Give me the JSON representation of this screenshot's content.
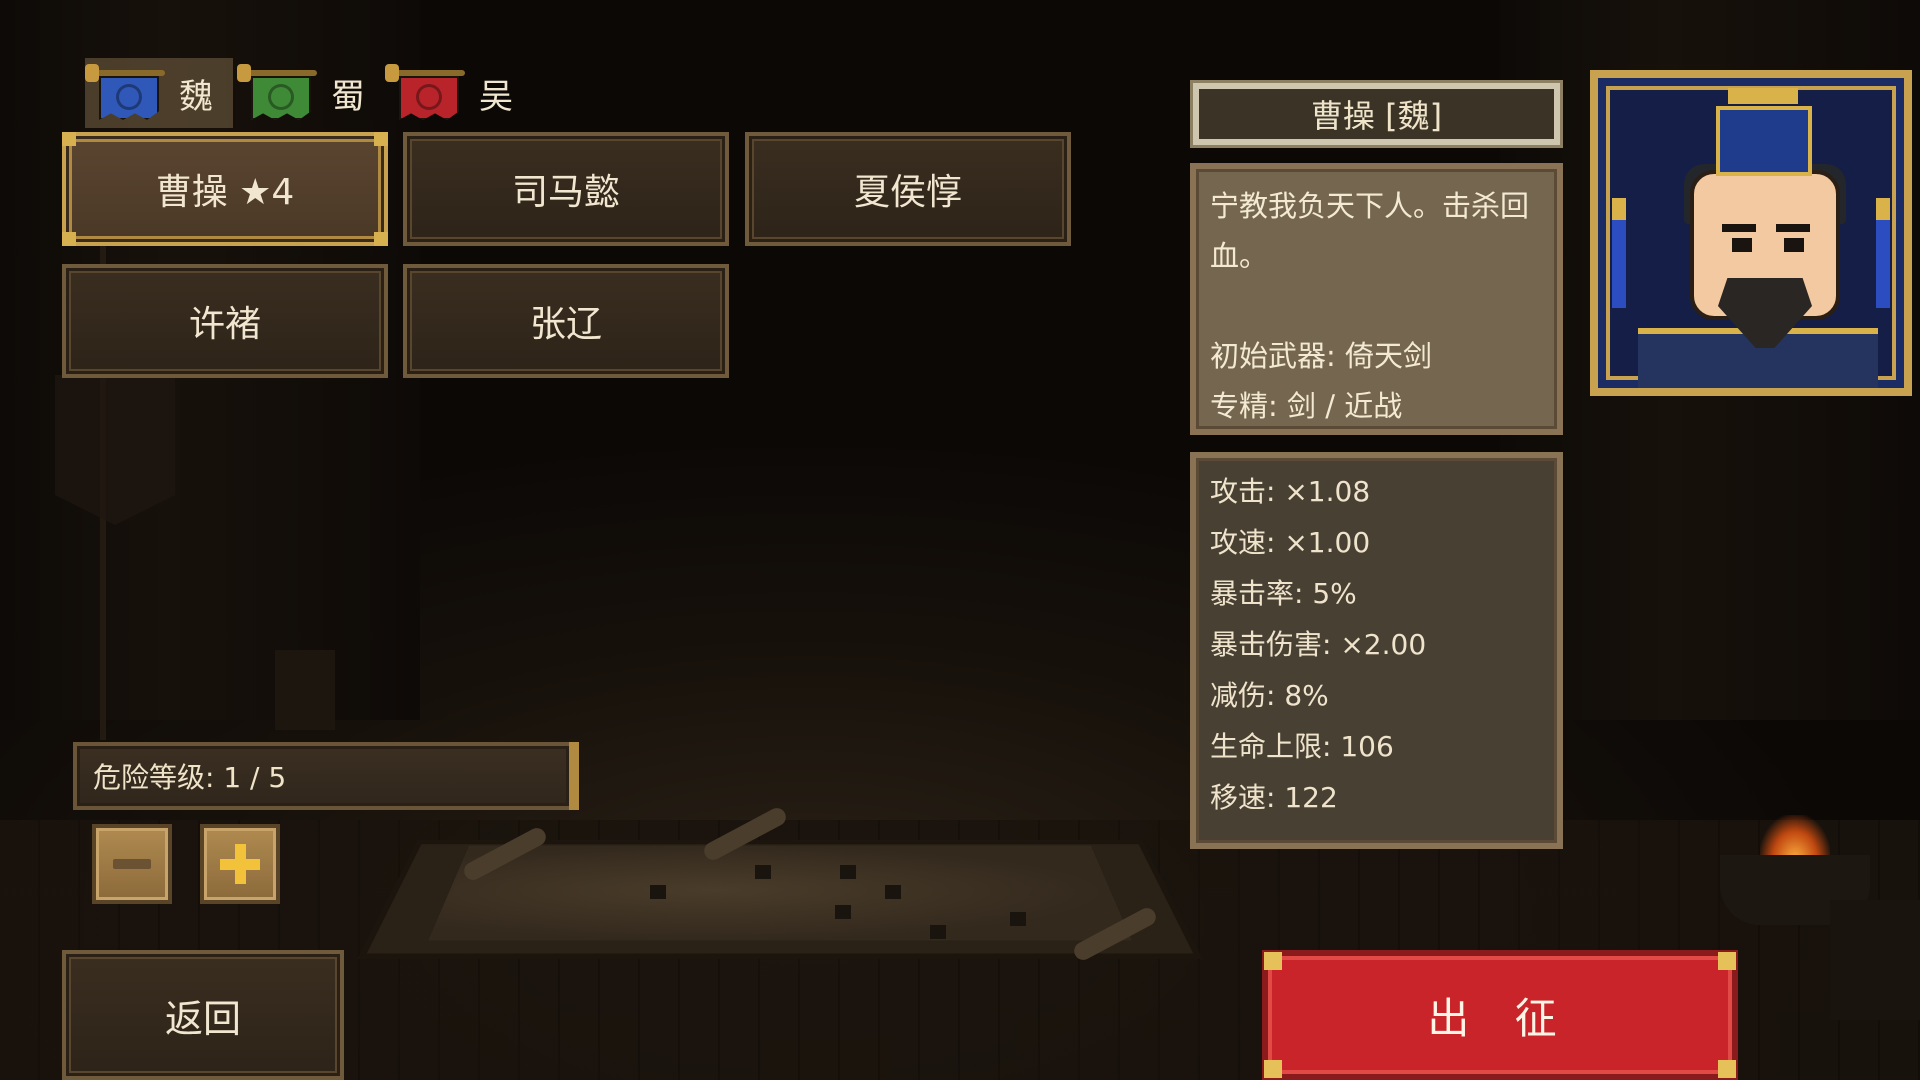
{
  "factions": [
    {
      "label": "魏",
      "color": "#2f58b8",
      "active": true
    },
    {
      "label": "蜀",
      "color": "#3f8a36",
      "active": false
    },
    {
      "label": "吴",
      "color": "#b8242a",
      "active": false
    }
  ],
  "generals": [
    {
      "label": "曹操 ★4",
      "selected": true
    },
    {
      "label": "司马懿",
      "selected": false
    },
    {
      "label": "夏侯惇",
      "selected": false
    },
    {
      "label": "许褚",
      "selected": false
    },
    {
      "label": "张辽",
      "selected": false
    }
  ],
  "danger": {
    "label": "危险等级: 1 / 5",
    "current": 1,
    "max": 5
  },
  "selected_general": {
    "name_title": "曹操 [魏]",
    "description_lines": [
      "宁教我负天下人。击杀回",
      "血。",
      "",
      "初始武器: 倚天剑",
      "专精: 剑 / 近战"
    ],
    "stats": [
      "攻击: ×1.08",
      "攻速: ×1.00",
      "暴击率: 5%",
      "暴击伤害: ×2.00",
      "减伤: 8%",
      "生命上限: 106",
      "移速: 122"
    ]
  },
  "buttons": {
    "back": "返回",
    "deploy": "出 征"
  },
  "colors": {
    "accent_gold": "#c9a24f",
    "deploy_red": "#c9242a",
    "panel_brown": "#75664f"
  },
  "icons": {
    "minus": "minus-icon",
    "plus": "plus-icon"
  }
}
